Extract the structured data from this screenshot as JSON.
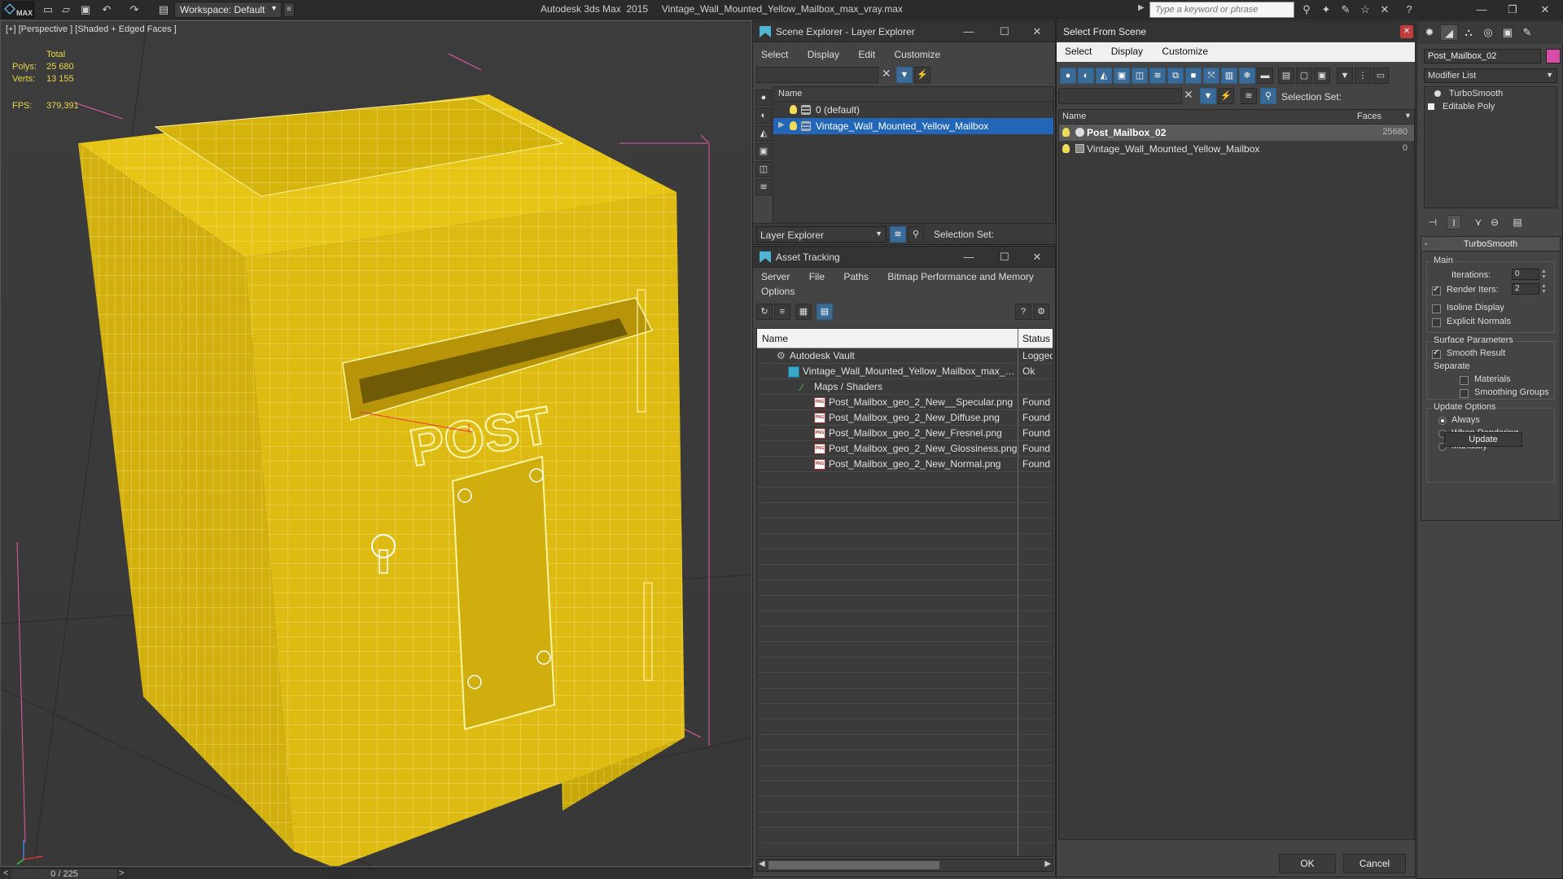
{
  "titlebar": {
    "logo": "MAX",
    "workspace_label": "Workspace: Default",
    "title": "Autodesk 3ds Max  2015     Vintage_Wall_Mounted_Yellow_Mailbox_max_vray.max",
    "search_placeholder": "Type a keyword or phrase"
  },
  "viewport": {
    "label": "[+] [Perspective ] [Shaded + Edged Faces ]",
    "stats": {
      "total_label": "Total",
      "polys_label": "Polys:",
      "polys_value": "25 680",
      "verts_label": "Verts:",
      "verts_value": "13 155",
      "fps_label": "FPS:",
      "fps_value": "379,391"
    },
    "mailbox_text": "POST",
    "timeline": {
      "frame": "0 / 225",
      "prev": "<",
      "next": ">"
    }
  },
  "layer_explorer": {
    "title": "Scene Explorer - Layer Explorer",
    "menu": [
      "Select",
      "Display",
      "Edit",
      "Customize"
    ],
    "column": "Name",
    "rows": [
      {
        "label": "0 (default)"
      },
      {
        "label": "Vintage_Wall_Mounted_Yellow_Mailbox"
      }
    ],
    "bottom_dropdown": "Layer Explorer",
    "selection_set_label": "Selection Set:"
  },
  "asset_tracking": {
    "title": "Asset Tracking",
    "menu_row1": [
      "Server",
      "File",
      "Paths",
      "Bitmap Performance and Memory"
    ],
    "menu_row2": [
      "Options"
    ],
    "columns": {
      "name": "Name",
      "status": "Status"
    },
    "rows": [
      {
        "name": "Autodesk Vault",
        "status": "Logged"
      },
      {
        "name": "Vintage_Wall_Mounted_Yellow_Mailbox_max_vr...",
        "status": "Ok"
      },
      {
        "name": "Maps / Shaders",
        "status": ""
      },
      {
        "name": "Post_Mailbox_geo_2_New__Specular.png",
        "status": "Found"
      },
      {
        "name": "Post_Mailbox_geo_2_New_Diffuse.png",
        "status": "Found"
      },
      {
        "name": "Post_Mailbox_geo_2_New_Fresnel.png",
        "status": "Found"
      },
      {
        "name": "Post_Mailbox_geo_2_New_Glossiness.png",
        "status": "Found"
      },
      {
        "name": "Post_Mailbox_geo_2_New_Normal.png",
        "status": "Found"
      }
    ],
    "png_badge": "PNG"
  },
  "select_from_scene": {
    "title": "Select From Scene",
    "menu": [
      "Select",
      "Display",
      "Customize"
    ],
    "selection_set_label": "Selection Set:",
    "columns": {
      "name": "Name",
      "faces": "Faces"
    },
    "rows": [
      {
        "name": "Post_Mailbox_02",
        "faces": "25680"
      },
      {
        "name": "Vintage_Wall_Mounted_Yellow_Mailbox",
        "faces": "0"
      }
    ],
    "ok": "OK",
    "cancel": "Cancel"
  },
  "command_panel": {
    "object_name": "Post_Mailbox_02",
    "object_color": "#d64ea8",
    "modifier_list": "Modifier List",
    "stack": [
      "TurboSmooth",
      "Editable Poly"
    ],
    "turbosmooth": {
      "title": "TurboSmooth",
      "main_label": "Main",
      "iterations_label": "Iterations:",
      "iterations_value": "0",
      "render_iters_label": "Render Iters:",
      "render_iters_value": "2",
      "isoline_label": "Isoline Display",
      "explicit_normals_label": "Explicit Normals",
      "surface_label": "Surface Parameters",
      "smooth_result_label": "Smooth Result",
      "separate_label": "Separate",
      "materials_label": "Materials",
      "smoothing_groups_label": "Smoothing Groups",
      "update_options_label": "Update Options",
      "always_label": "Always",
      "when_rendering_label": "When Rendering",
      "manually_label": "Manually",
      "update_button": "Update"
    }
  }
}
